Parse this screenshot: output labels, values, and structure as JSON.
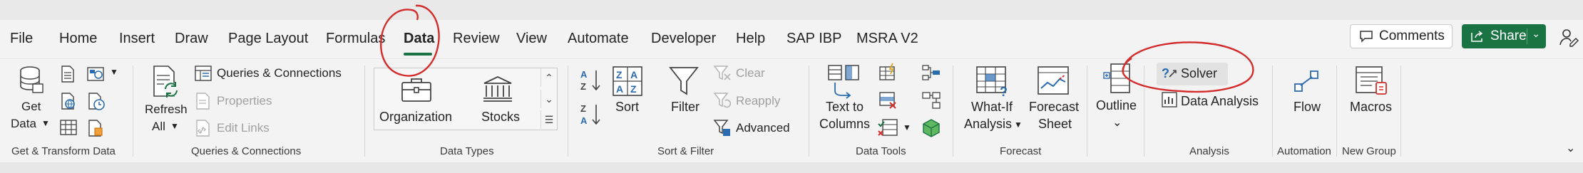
{
  "tabs": [
    "File",
    "Home",
    "Insert",
    "Draw",
    "Page Layout",
    "Formulas",
    "Data",
    "Review",
    "View",
    "Automate",
    "Developer",
    "Help",
    "SAP IBP",
    "MSRA V2"
  ],
  "header": {
    "comments": "Comments",
    "share": "Share"
  },
  "get_transform": {
    "get_data_line1": "Get",
    "get_data_line2": "Data",
    "group": "Get & Transform Data"
  },
  "queries": {
    "refresh_line1": "Refresh",
    "refresh_line2": "All",
    "queries_connections": "Queries & Connections",
    "properties": "Properties",
    "edit_links": "Edit Links",
    "group": "Queries & Connections"
  },
  "data_types": {
    "organization": "Organization",
    "stocks": "Stocks",
    "group": "Data Types"
  },
  "sort_filter": {
    "sort": "Sort",
    "filter": "Filter",
    "clear": "Clear",
    "reapply": "Reapply",
    "advanced": "Advanced",
    "group": "Sort & Filter"
  },
  "data_tools": {
    "text_to_line1": "Text to",
    "text_to_line2": "Columns",
    "group": "Data Tools"
  },
  "forecast": {
    "whatif_line1": "What-If",
    "whatif_line2": "Analysis",
    "sheet_line1": "Forecast",
    "sheet_line2": "Sheet",
    "group": "Forecast"
  },
  "outline": {
    "label": "Outline"
  },
  "analysis": {
    "solver": "Solver",
    "data_analysis": "Data Analysis",
    "group": "Analysis"
  },
  "automation": {
    "flow": "Flow",
    "group": "Automation"
  },
  "new_group": {
    "macros": "Macros",
    "group": "New Group"
  },
  "colors": {
    "accent": "#1a7343",
    "annotation": "#d42b2b",
    "blue_icon": "#2b6cb0"
  }
}
